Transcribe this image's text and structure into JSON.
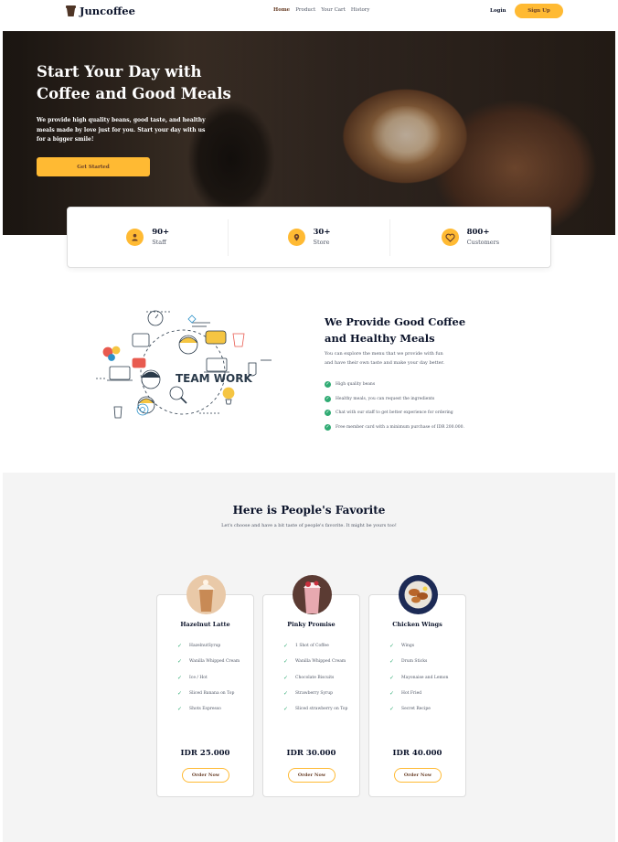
{
  "brand": {
    "name": "Juncoffee"
  },
  "nav": {
    "links": [
      "Home",
      "Product",
      "Your Cart",
      "History"
    ],
    "login": "Login",
    "signup": "Sign Up"
  },
  "hero": {
    "title": "Start Your Day with Coffee and Good Meals",
    "description": "We provide high quality beans, good taste, and healthy meals made by love just for you. Start your day with us for a bigger smile!",
    "cta": "Get Started"
  },
  "stats": [
    {
      "value": "90+",
      "label": "Staff",
      "icon": "person-icon"
    },
    {
      "value": "30+",
      "label": "Store",
      "icon": "location-pin-icon"
    },
    {
      "value": "800+",
      "label": "Customers",
      "icon": "heart-icon"
    }
  ],
  "provide": {
    "illustration_text": "TEAM WORK",
    "title": "We Provide Good Coffee and Healthy Meals",
    "description": "You can explore the menu that we provide with fun and have their own taste and make your day better.",
    "benefits": [
      "High quality beans",
      "Healthy meals, you can request the ingredients",
      "Chat with our staff to get better experience for ordering",
      "Free member card with a minimum purchase of IDR 200.000."
    ]
  },
  "favorites": {
    "title": "Here is People's Favorite",
    "subtitle": "Let's choose and have a bit taste of people's favorite. It might be yours too!",
    "items": [
      {
        "name": "Hazelnut Latte",
        "ingredients": [
          "HazelnutSyrup",
          "Wanilla Whipped Cream",
          "Ice / Hot",
          "Sliced Banana on Top",
          "Shots Espresso"
        ],
        "price": "IDR 25.000",
        "button": "Order Now"
      },
      {
        "name": "Pinky Promise",
        "ingredients": [
          "1 Shot of Coffee",
          "Wanilla Whipped Cream",
          "Chocolate Biscuits",
          "Strawberry Syrup",
          "Sliced strawberry on Top"
        ],
        "price": "IDR 30.000",
        "button": "Order Now"
      },
      {
        "name": "Chicken Wings",
        "ingredients": [
          "Wings",
          "Drum Sticks",
          "Mayonaise and Lemon",
          "Hot Fried",
          "Secret Recipe"
        ],
        "price": "IDR 40.000",
        "button": "Order Now"
      }
    ]
  },
  "colors": {
    "accent": "#ffba33",
    "brown": "#6a4029",
    "check": "#2fab73",
    "text": "#0b132a",
    "muted": "#4f5665"
  }
}
